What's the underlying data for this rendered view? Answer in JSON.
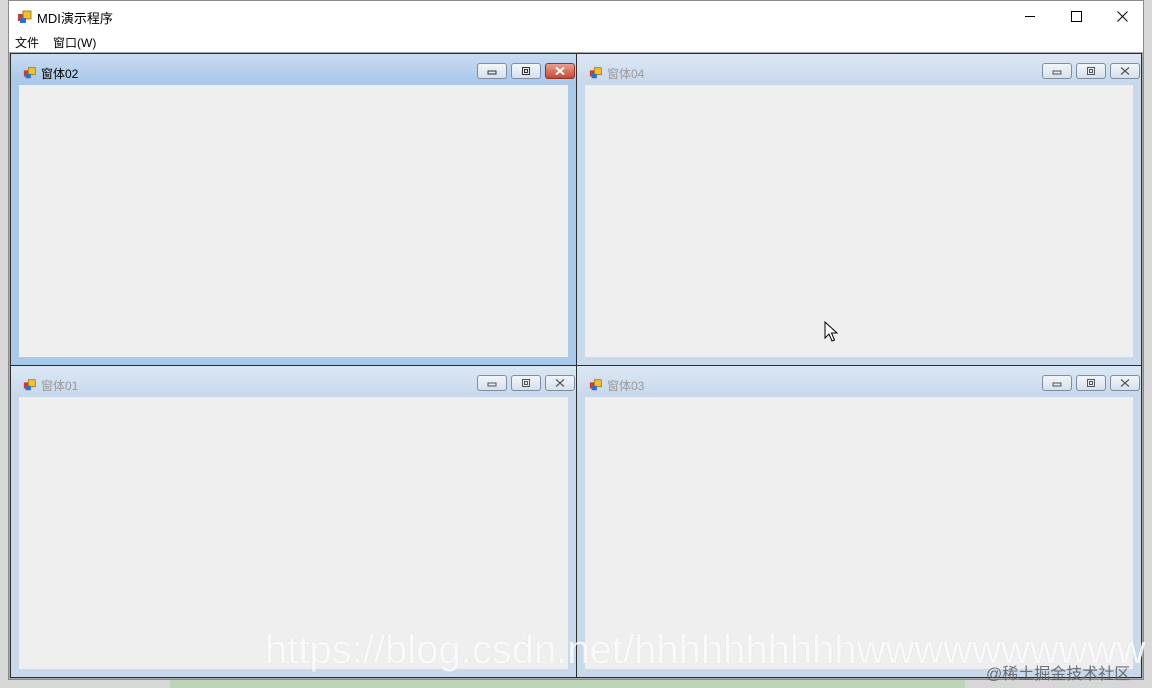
{
  "app": {
    "title": "MDI演示程序",
    "icon": "app-window-icon",
    "controls": [
      "minimize-icon",
      "maximize-icon",
      "close-icon"
    ]
  },
  "menu": {
    "items": [
      {
        "label": "文件"
      },
      {
        "label": "窗口(W)"
      }
    ]
  },
  "children": [
    {
      "title": "窗体02",
      "active": true
    },
    {
      "title": "窗体04",
      "active": false
    },
    {
      "title": "窗体01",
      "active": false
    },
    {
      "title": "窗体03",
      "active": false
    }
  ],
  "watermark": {
    "url": "https://blog.csdn.net/hhhhhhhhhhwwwwwwwwww",
    "site": "@稀土掘金技术社区"
  },
  "colors": {
    "active_title": "#a7c6e9",
    "inactive_title": "#c7d8ec",
    "close_active": "#c54a32",
    "client_bg": "#efefef"
  }
}
